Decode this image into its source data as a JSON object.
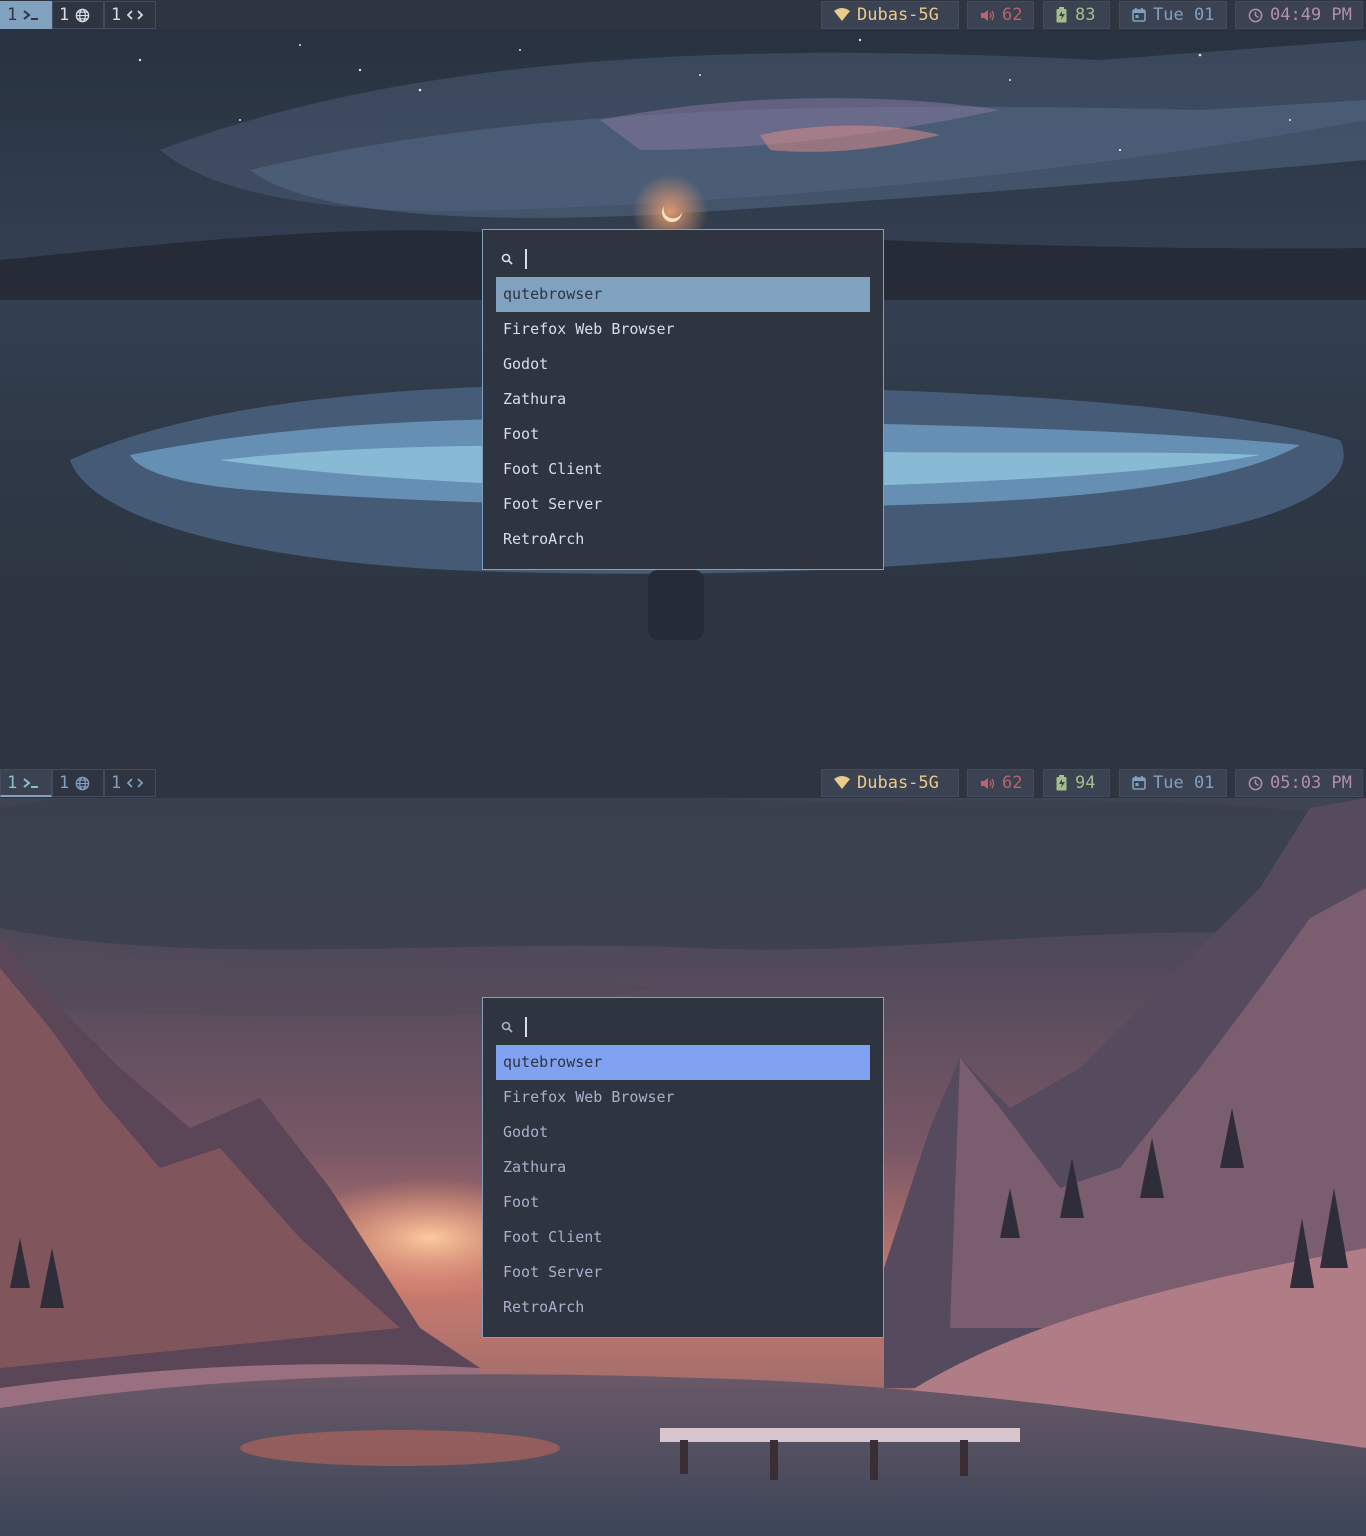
{
  "screens": [
    {
      "workspaces": [
        {
          "num": "1",
          "icon": "terminal-icon"
        },
        {
          "num": "1",
          "icon": "globe-icon"
        },
        {
          "num": "1",
          "icon": "code-icon"
        }
      ],
      "status": {
        "wifi": "Dubas-5G",
        "volume": "62",
        "battery": "83",
        "date": "Tue 01",
        "time": "04:49 PM"
      },
      "launcher": {
        "query": "",
        "items": [
          "qutebrowser",
          "Firefox Web Browser",
          "Godot",
          "Zathura",
          "Foot",
          "Foot Client",
          "Foot Server",
          "RetroArch"
        ],
        "selected": 0
      }
    },
    {
      "workspaces": [
        {
          "num": "1",
          "icon": "terminal-icon"
        },
        {
          "num": "1",
          "icon": "globe-icon"
        },
        {
          "num": "1",
          "icon": "code-icon"
        }
      ],
      "status": {
        "wifi": "Dubas-5G",
        "volume": "62",
        "battery": "94",
        "date": "Tue 01",
        "time": "05:03 PM"
      },
      "launcher": {
        "query": "",
        "items": [
          "qutebrowser",
          "Firefox Web Browser",
          "Godot",
          "Zathura",
          "Foot",
          "Foot Client",
          "Foot Server",
          "RetroArch"
        ],
        "selected": 0
      }
    }
  ],
  "colors": {
    "bar_bg": "#2e3440",
    "accent": "#81a1c1",
    "wifi": "#ebcb8b",
    "volume": "#bf616a",
    "battery": "#a3be8c",
    "date": "#81a1c1",
    "clock": "#b48ead"
  }
}
